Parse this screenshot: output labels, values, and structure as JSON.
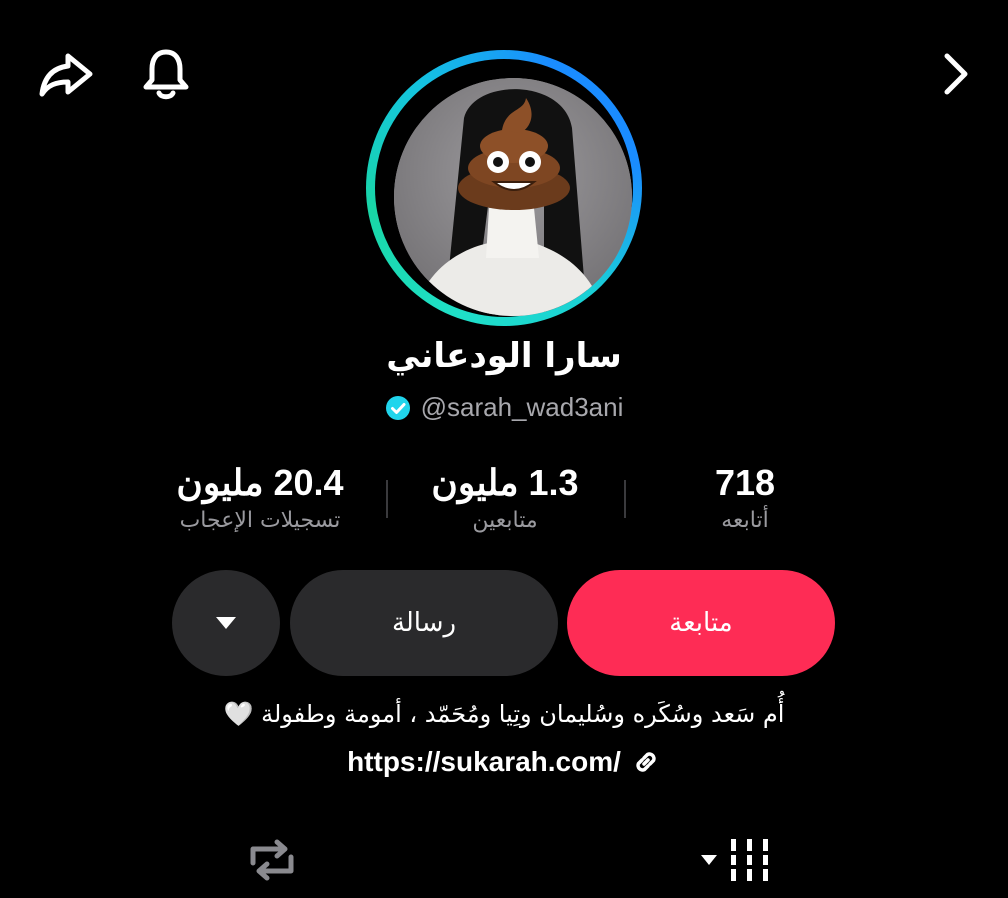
{
  "profile": {
    "display_name": "سارا الودعاني",
    "handle": "@sarah_wad3ani",
    "verified": true,
    "ring_colors": [
      "#1fe0c8",
      "#1a8cff"
    ]
  },
  "stats": {
    "likes": {
      "value": "20.4 مليون",
      "label": "تسجيلات الإعجاب"
    },
    "followers": {
      "value": "1.3 مليون",
      "label": "متابعين"
    },
    "following": {
      "value": "718",
      "label": "أتابعه"
    }
  },
  "actions": {
    "follow_label": "متابعة",
    "message_label": "رسالة",
    "more_icon": "caret-down-icon"
  },
  "bio": {
    "text": "أُم سَعد وسُكَره وسُليمان وتِيا ومُحَمّد ، أمومة وطفولة 🤍",
    "link": "https://sukarah.com/"
  },
  "colors": {
    "accent": "#fe2c55",
    "button_secondary": "#2a2a2c",
    "verified": "#20d5ec"
  },
  "icons": {
    "top_left": [
      "share-icon",
      "bell-icon"
    ],
    "top_right": "chevron-right-icon",
    "tabs": [
      "repost-icon",
      "grid-icon"
    ]
  }
}
